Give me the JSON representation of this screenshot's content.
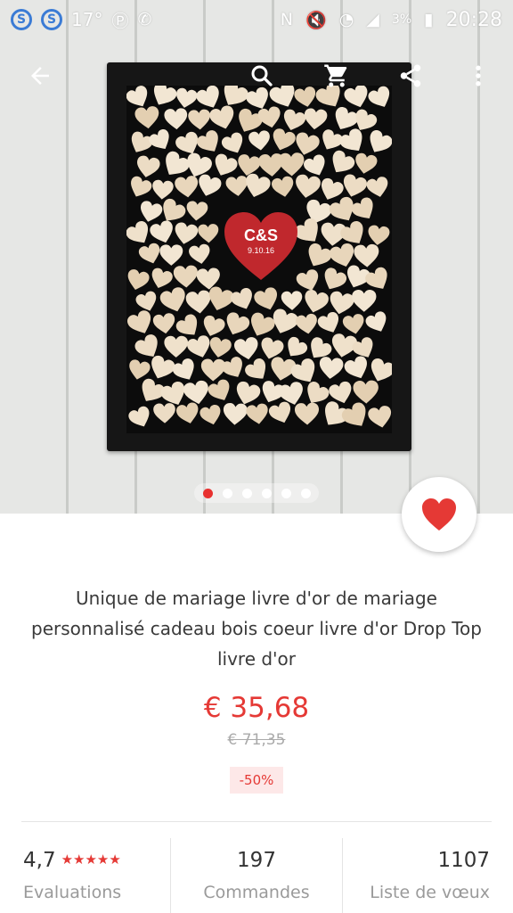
{
  "status_bar": {
    "temperature": "17°",
    "time": "20:28",
    "battery": "3%",
    "left_icons": [
      "skype-icon",
      "skype-icon",
      "pinterest-icon",
      "missed-call-icon"
    ],
    "right_icons": [
      "nfc-icon",
      "mute-icon",
      "wifi-icon",
      "signal-icon",
      "battery-icon"
    ]
  },
  "toolbar": {
    "icons": [
      "back-arrow-icon",
      "search-icon",
      "cart-icon",
      "share-icon",
      "more-vert-icon"
    ]
  },
  "product_image": {
    "heart_initials": "C&S",
    "heart_date": "9.10.16",
    "carousel_count": 6,
    "carousel_active_index": 0
  },
  "product": {
    "title": "Unique de mariage livre d'or de mariage personnalisé cadeau bois coeur livre d'or Drop Top livre d'or",
    "price": "€ 35,68",
    "old_price": "€ 71,35",
    "discount": "-50%"
  },
  "stats": {
    "rating_value": "4,7",
    "rating_stars": 5,
    "rating_label": "Evaluations",
    "orders_value": "197",
    "orders_label": "Commandes",
    "wishlist_value": "1107",
    "wishlist_label": "Liste de vœux"
  },
  "colors": {
    "accent": "#e53935",
    "frame": "#161616",
    "heart_wood": "#ecdcc4"
  }
}
